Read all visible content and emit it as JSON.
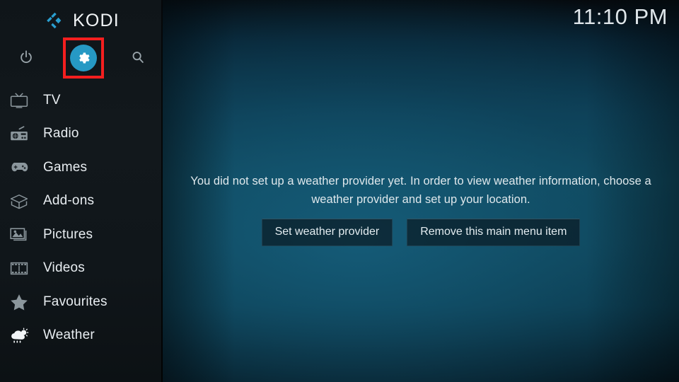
{
  "app": {
    "name": "KODI",
    "logo_icon": "kodi-logo-icon",
    "accent_color": "#2699c4",
    "highlight_color": "#f41f1f",
    "sidebar_bg": "#12181c"
  },
  "header": {
    "clock": "11:10 PM"
  },
  "top_actions": [
    {
      "id": "power",
      "icon": "power-icon",
      "label": "Power"
    },
    {
      "id": "settings",
      "icon": "gear-icon",
      "label": "Settings",
      "selected": true
    },
    {
      "id": "search",
      "icon": "search-icon",
      "label": "Search"
    }
  ],
  "sidebar": {
    "items": [
      {
        "label": "TV",
        "icon": "tv-icon"
      },
      {
        "label": "Radio",
        "icon": "radio-icon"
      },
      {
        "label": "Games",
        "icon": "gamepad-icon"
      },
      {
        "label": "Add-ons",
        "icon": "box-icon"
      },
      {
        "label": "Pictures",
        "icon": "picture-icon"
      },
      {
        "label": "Videos",
        "icon": "filmstrip-icon"
      },
      {
        "label": "Favourites",
        "icon": "star-icon"
      },
      {
        "label": "Weather",
        "icon": "weather-cloud-sun-rain-icon"
      }
    ]
  },
  "main": {
    "notice": "You did not set up a weather provider yet. In order to view weather information, choose a weather provider and set up your location.",
    "buttons": [
      {
        "label": "Set weather provider"
      },
      {
        "label": "Remove this main menu item"
      }
    ]
  }
}
